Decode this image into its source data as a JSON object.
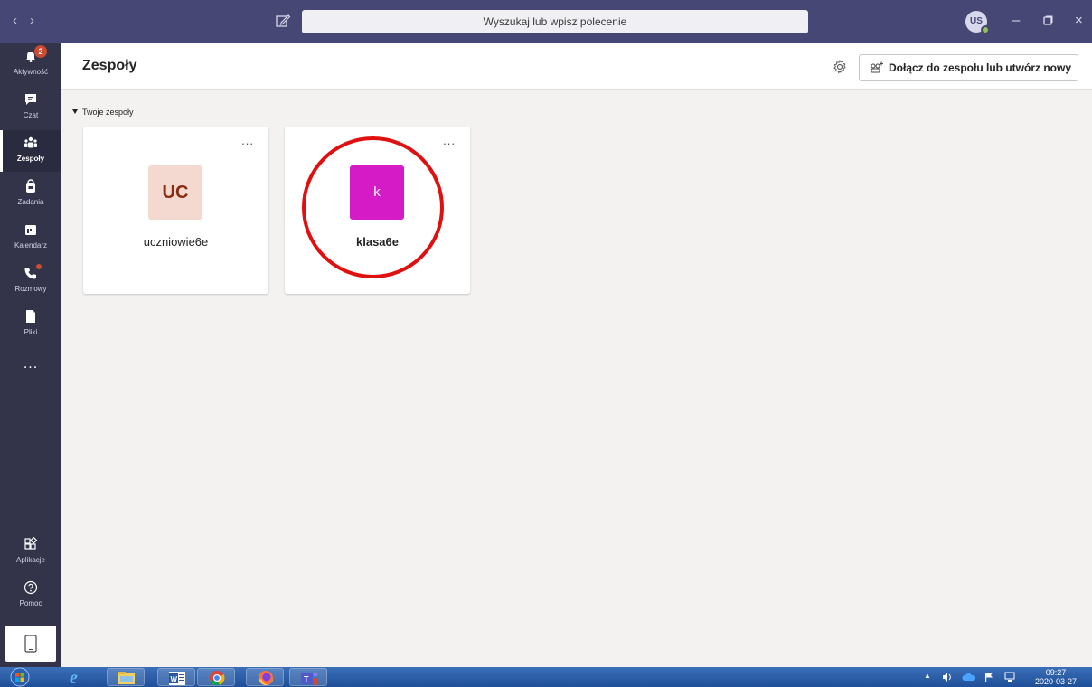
{
  "titlebar": {
    "search_placeholder": "Wyszukaj lub wpisz polecenie",
    "user_initials": "US"
  },
  "rail": {
    "items": [
      {
        "label": "Aktywność",
        "badge": "2"
      },
      {
        "label": "Czat"
      },
      {
        "label": "Zespoły"
      },
      {
        "label": "Zadania"
      },
      {
        "label": "Kalendarz"
      },
      {
        "label": "Rozmowy"
      },
      {
        "label": "Pliki"
      }
    ],
    "more": "...",
    "apps_label": "Aplikacje",
    "help_label": "Pomoc"
  },
  "main": {
    "title": "Zespoły",
    "join_button": "Dołącz do zespołu lub utwórz nowy",
    "section_label": "Twoje zespoły",
    "teams": [
      {
        "initials": "UC",
        "name": "uczniowie6e",
        "tile_color": "#f4d9d0",
        "text_color": "#8a2c0f"
      },
      {
        "initials": "k",
        "name": "klasa6e",
        "tile_color": "#d41bc5",
        "text_color": "#ffffff"
      }
    ],
    "more_glyph": "..."
  },
  "taskbar": {
    "time": "09:27",
    "date": "2020-03-27"
  },
  "colors": {
    "titlebar": "#464775",
    "rail": "#33344a",
    "highlight_ring": "#e01010"
  }
}
